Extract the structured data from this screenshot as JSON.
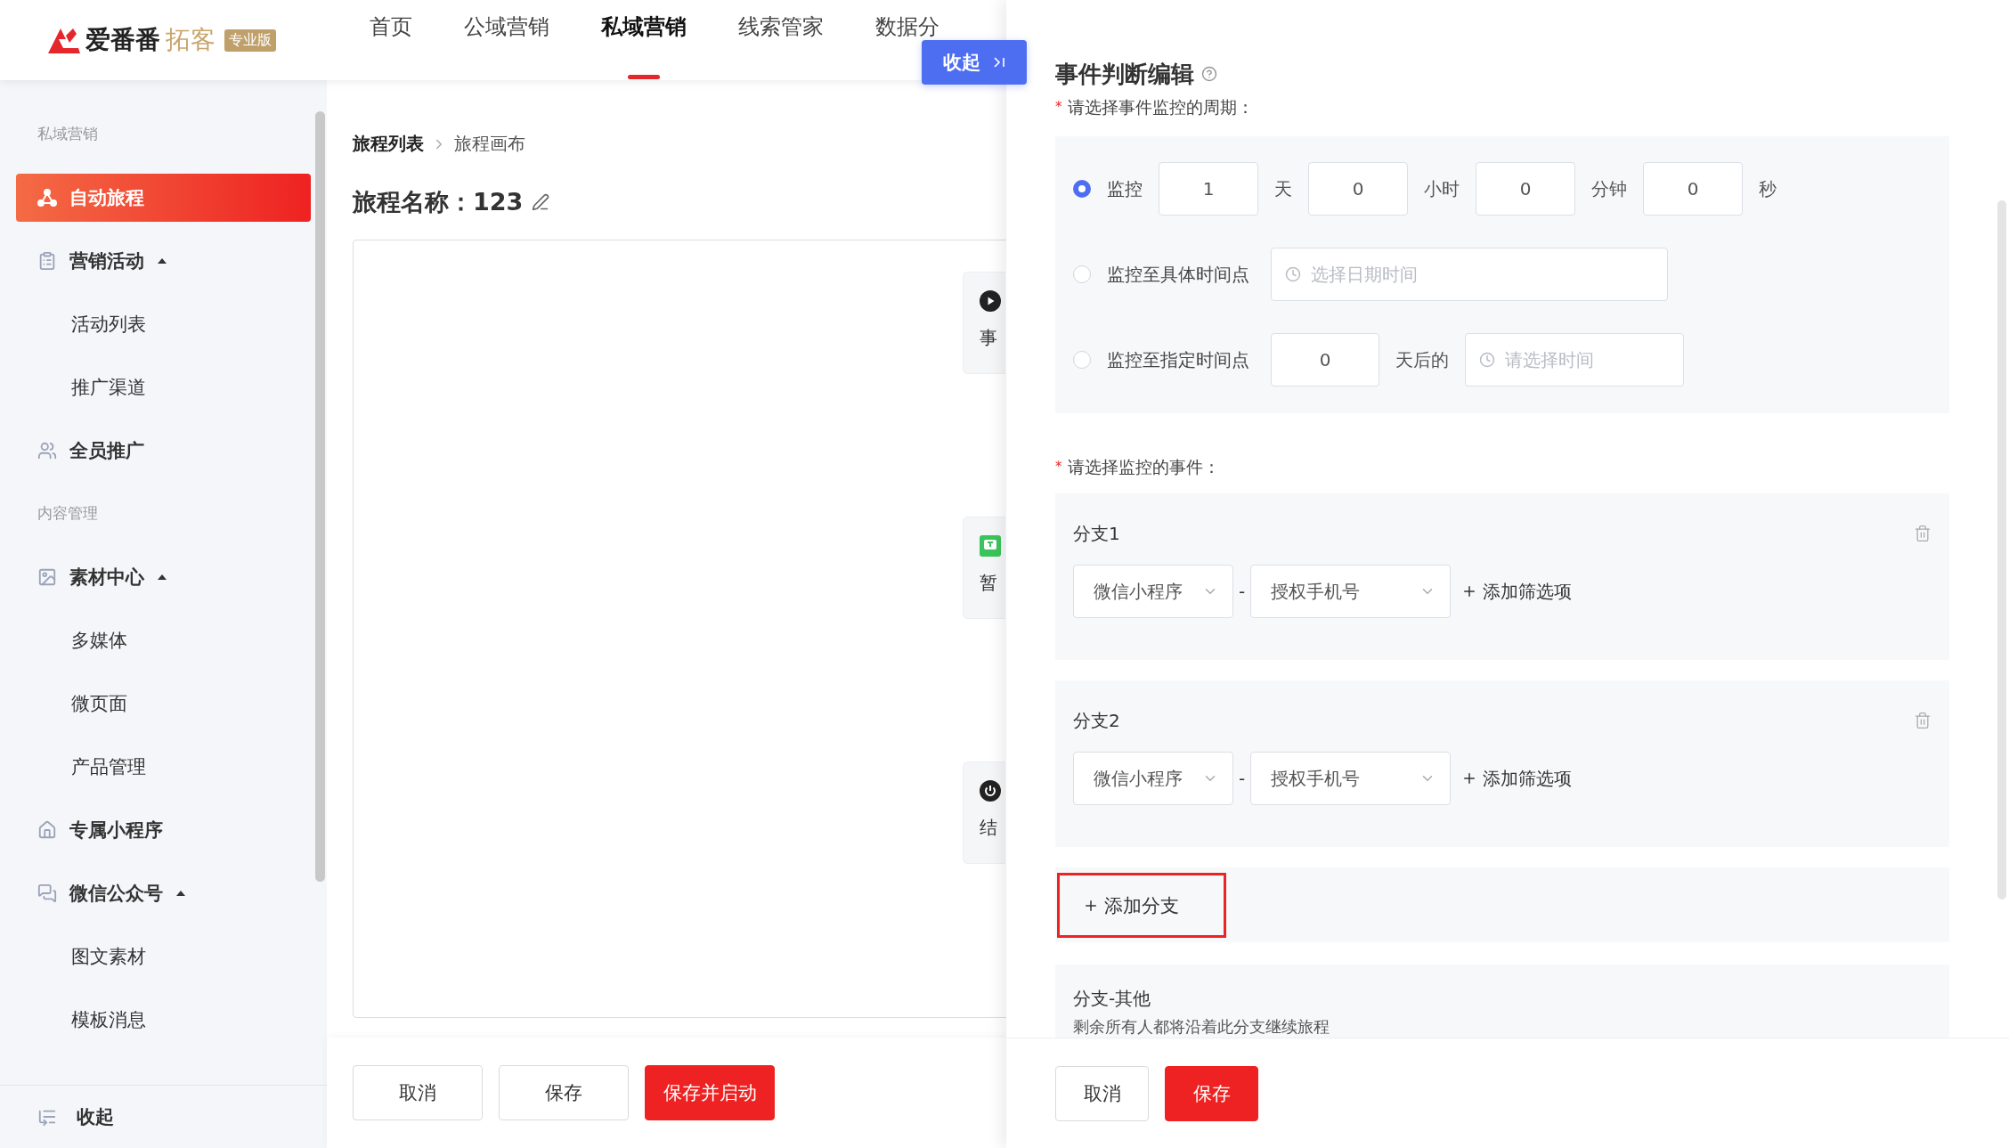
{
  "header": {
    "logo": {
      "brand": "爱番番",
      "product": "拓客",
      "badge": "专业版"
    },
    "nav": [
      {
        "label": "首页",
        "selected": false
      },
      {
        "label": "公域营销",
        "selected": false
      },
      {
        "label": "私域营销",
        "selected": true
      },
      {
        "label": "线索管家",
        "selected": false
      },
      {
        "label": "数据分",
        "selected": false
      }
    ]
  },
  "sidebar": {
    "sections": [
      {
        "title": "私域营销",
        "items": [
          {
            "label": "自动旅程",
            "kind": "journey",
            "selected": true
          },
          {
            "label": "营销活动",
            "kind": "clipboard",
            "selected": false,
            "expanded": true,
            "children": [
              {
                "label": "活动列表",
                "selected": false
              },
              {
                "label": "推广渠道",
                "selected": false
              }
            ]
          },
          {
            "label": "全员推广",
            "kind": "people",
            "selected": false
          }
        ]
      },
      {
        "title": "内容管理",
        "items": [
          {
            "label": "素材中心",
            "kind": "image",
            "selected": false,
            "expanded": true,
            "children": [
              {
                "label": "多媒体",
                "selected": false
              },
              {
                "label": "微页面",
                "selected": false
              },
              {
                "label": "产品管理",
                "selected": false
              }
            ]
          },
          {
            "label": "专属小程序",
            "kind": "miniapp",
            "selected": false
          },
          {
            "label": "微信公众号",
            "kind": "wechat",
            "selected": false,
            "expanded": true,
            "children": [
              {
                "label": "图文素材",
                "selected": false
              },
              {
                "label": "模板消息",
                "selected": false
              }
            ]
          }
        ]
      }
    ],
    "collapse_label": "收起"
  },
  "main": {
    "breadcrumb": [
      "旅程列表",
      "旅程画布"
    ],
    "title_label": "旅程名称：",
    "title_value": "123",
    "nodes": [
      {
        "kind": "start",
        "label": "事"
      },
      {
        "kind": "message",
        "label": "暂"
      },
      {
        "kind": "end",
        "label": "结"
      }
    ],
    "buttons": [
      {
        "label": "取消",
        "kind": "default"
      },
      {
        "label": "保存",
        "kind": "default"
      },
      {
        "label": "保存并启动",
        "kind": "primary"
      }
    ]
  },
  "drawer_toggle": {
    "label": "收起"
  },
  "drawer": {
    "title": "事件判断编辑",
    "period_label": {
      "mark": "*",
      "text": "请选择事件监控的周期："
    },
    "period_options": [
      {
        "kind": "duration",
        "label": "监控",
        "selected": true,
        "fields": [
          {
            "value": "1",
            "unit": "天"
          },
          {
            "value": "0",
            "unit": "小时"
          },
          {
            "value": "0",
            "unit": "分钟"
          },
          {
            "value": "0",
            "unit": "秒"
          }
        ]
      },
      {
        "kind": "datetime",
        "label": "监控至具体时间点",
        "selected": false,
        "placeholder": "选择日期时间"
      },
      {
        "kind": "day_time",
        "label": "监控至指定时间点",
        "selected": false,
        "days": "0",
        "unit": "天后的",
        "placeholder": "请选择时间"
      }
    ],
    "events_label": {
      "mark": "*",
      "text": "请选择监控的事件："
    },
    "branches": [
      {
        "title": "分支1",
        "source": "微信小程序",
        "separator": "-",
        "event": "授权手机号",
        "add_filter": "添加筛选项"
      },
      {
        "title": "分支2",
        "source": "微信小程序",
        "separator": "-",
        "event": "授权手机号",
        "add_filter": "添加筛选项"
      }
    ],
    "add_branch": "添加分支",
    "other": {
      "title": "分支-其他",
      "description": "剩余所有人都将沿着此分支继续旅程"
    },
    "buttons": [
      {
        "label": "取消",
        "kind": "default"
      },
      {
        "label": "保存",
        "kind": "primary"
      }
    ]
  }
}
